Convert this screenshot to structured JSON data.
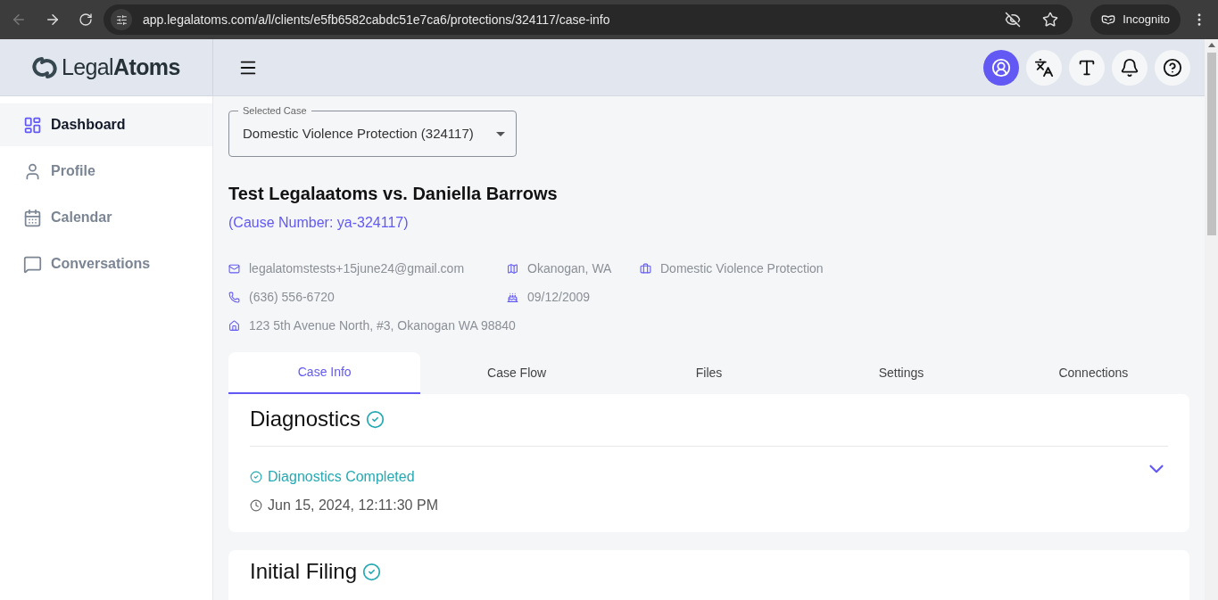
{
  "browser": {
    "url": "app.legalatoms.com/a/l/clients/e5fb6582cabdc51e7ca6/protections/324117/case-info",
    "profile": "Incognito"
  },
  "logo": {
    "light": "Legal",
    "bold": "Atoms"
  },
  "header_buttons": [
    {
      "kind": "profile",
      "selected": true
    },
    {
      "kind": "translate",
      "selected": false
    },
    {
      "kind": "text-size",
      "selected": false
    },
    {
      "kind": "bell",
      "selected": false
    },
    {
      "kind": "help",
      "selected": false
    }
  ],
  "sidebar": {
    "items": [
      {
        "label": "Dashboard",
        "kind": "dashboard",
        "selected": true
      },
      {
        "label": "Profile",
        "kind": "profile",
        "selected": false
      },
      {
        "label": "Calendar",
        "kind": "calendar",
        "selected": false
      },
      {
        "label": "Conversations",
        "kind": "chat",
        "selected": false
      }
    ]
  },
  "case_select": {
    "label": "Selected Case",
    "value": "Domestic Violence Protection (324117)"
  },
  "case": {
    "title": "Test Legalaatoms vs. Daniella Barrows",
    "cause_number": "(Cause Number: ya-324117)"
  },
  "details": [
    {
      "kind": "email",
      "text": "legalatomstests+15june24@gmail.com"
    },
    {
      "kind": "map",
      "text": "Okanogan, WA"
    },
    {
      "kind": "case-type",
      "text": "Domestic Violence Protection"
    },
    {
      "kind": "phone",
      "text": "(636) 556-6720"
    },
    {
      "kind": "birthday",
      "text": "09/12/2009"
    },
    {
      "kind": "home",
      "text": "123 5th Avenue North, #3, Okanogan WA 98840"
    }
  ],
  "tabs": [
    {
      "label": "Case Info",
      "selected": true
    },
    {
      "label": "Case Flow",
      "selected": false
    },
    {
      "label": "Files",
      "selected": false
    },
    {
      "label": "Settings",
      "selected": false
    },
    {
      "label": "Connections",
      "selected": false
    }
  ],
  "sections": [
    {
      "title": "Diagnostics",
      "completed": true,
      "status": "Diagnostics Completed",
      "timestamp": "Jun 15, 2024, 12:11:30 PM",
      "expanded": false
    },
    {
      "title": "Initial Filing",
      "completed": true
    }
  ]
}
